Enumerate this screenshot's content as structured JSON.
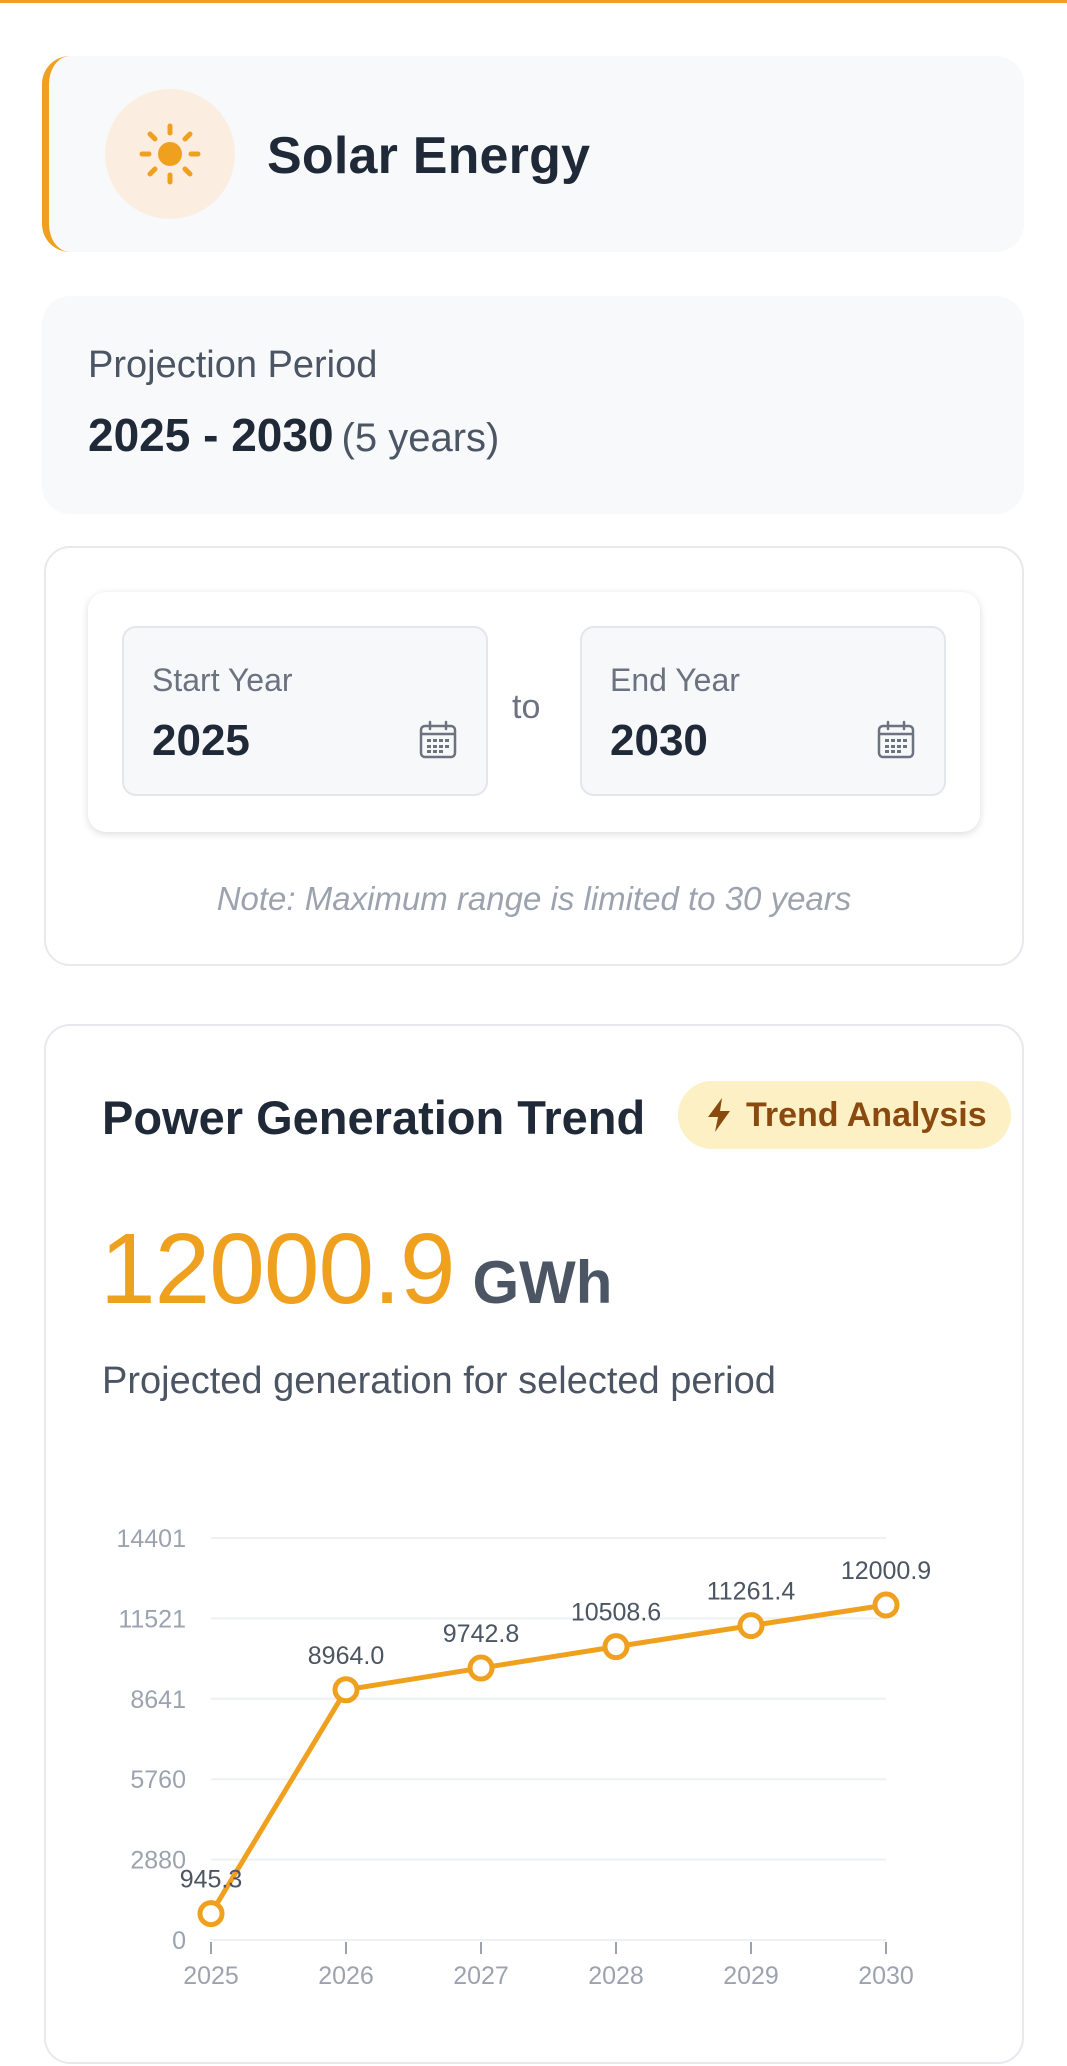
{
  "header": {
    "title": "Solar Energy",
    "icon": "sun-icon",
    "accent": "#f0a01f"
  },
  "projection": {
    "label": "Projection Period",
    "range": "2025 - 2030",
    "duration": "(5 years)"
  },
  "range_selector": {
    "start": {
      "label": "Start Year",
      "value": "2025",
      "icon": "calendar-icon"
    },
    "separator": "to",
    "end": {
      "label": "End Year",
      "value": "2030",
      "icon": "calendar-icon"
    },
    "note": "Note: Maximum range is limited to 30 years"
  },
  "trend": {
    "title": "Power Generation Trend",
    "badge": {
      "label": "Trend Analysis",
      "icon": "lightning-icon"
    },
    "total_value": "12000.9",
    "unit": "GWh",
    "subtitle": "Projected generation for selected period"
  },
  "chart_data": {
    "type": "line",
    "x": [
      "2025",
      "2026",
      "2027",
      "2028",
      "2029",
      "2030"
    ],
    "series": [
      {
        "values": [
          945.3,
          8964.0,
          9742.8,
          10508.6,
          11261.4,
          12000.9
        ],
        "labels": [
          "945.3",
          "8964.0",
          "9742.8",
          "10508.6",
          "11261.4",
          "12000.9"
        ]
      }
    ],
    "y_ticks": [
      "0",
      "2880",
      "5760",
      "8641",
      "11521",
      "14401"
    ],
    "ylim": [
      0,
      14401
    ],
    "grid": true,
    "color": "#f0a01f"
  }
}
